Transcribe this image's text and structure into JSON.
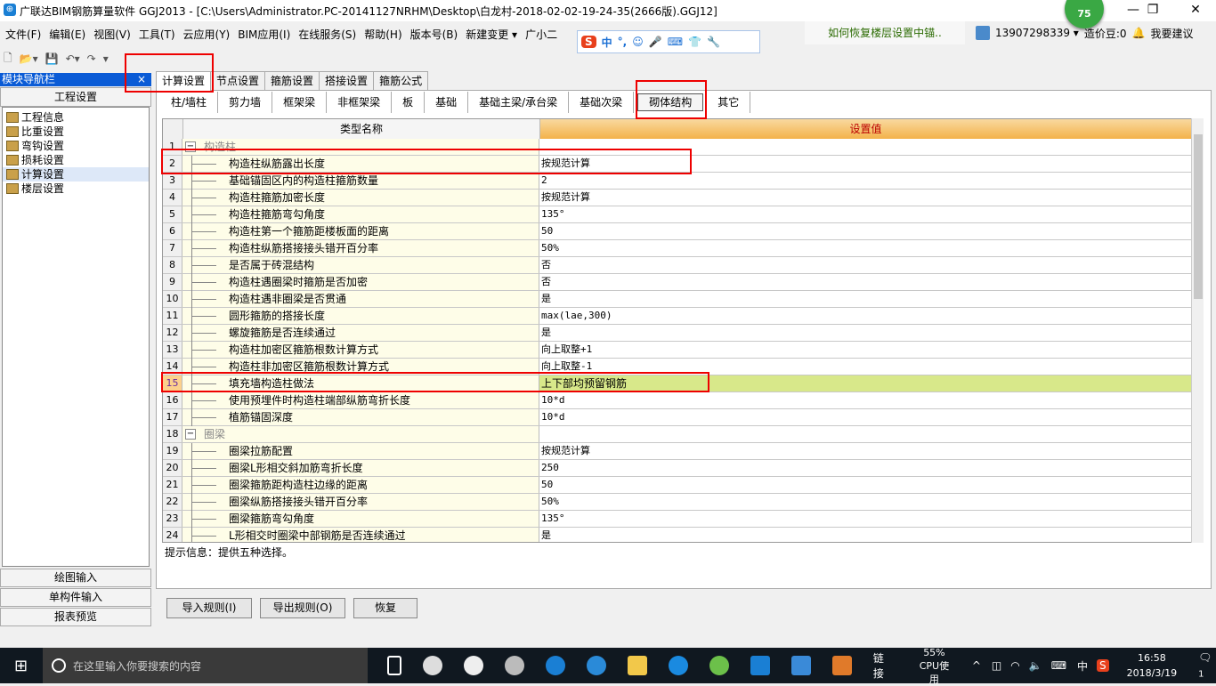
{
  "window": {
    "title": "广联达BIM钢筋算量软件 GGJ2013 - [C:\\Users\\Administrator.PC-20141127NRHM\\Desktop\\白龙村-2018-02-02-19-24-35(2666版).GGJ12]",
    "badge": "75",
    "minimize": "—",
    "restore": "❐",
    "close": "✕"
  },
  "menu": [
    "文件(F)",
    "编辑(E)",
    "视图(V)",
    "工具(T)",
    "云应用(Y)",
    "BIM应用(I)",
    "在线服务(S)",
    "帮助(H)",
    "版本号(B)",
    "新建变更 ▾",
    "广小二"
  ],
  "ime": {
    "logo": "S",
    "items": [
      "中",
      "°,",
      "☺",
      "🎤",
      "⌨",
      "👕",
      "🔧"
    ]
  },
  "news": "如何恢复楼层设置中锚..",
  "user": {
    "phone": "13907298339 ▾",
    "beans": "造价豆:0",
    "suggest": "我要建议"
  },
  "toolbar": [
    "🗋",
    "📂▾",
    "💾",
    "↶▾",
    "↷",
    "▾"
  ],
  "nav": {
    "header": "模块导航栏",
    "pin": "ᵖ",
    "close": "×",
    "section": "工程设置",
    "items": [
      "工程信息",
      "比重设置",
      "弯钩设置",
      "损耗设置",
      "计算设置",
      "楼层设置"
    ],
    "bottom": [
      "绘图输入",
      "单构件输入",
      "报表预览"
    ]
  },
  "main_tabs": [
    "计算设置",
    "节点设置",
    "箍筋设置",
    "搭接设置",
    "箍筋公式"
  ],
  "sub_tabs": [
    "柱/墙柱",
    "剪力墙",
    "框架梁",
    "非框架梁",
    "板",
    "基础",
    "基础主梁/承台梁",
    "基础次梁",
    "砌体结构",
    "其它"
  ],
  "grid": {
    "headers": [
      "类型名称",
      "设置值"
    ],
    "rows": [
      [
        "1",
        "构造柱",
        ""
      ],
      [
        "2",
        "构造柱纵筋露出长度",
        "按规范计算"
      ],
      [
        "3",
        "基础锚固区内的构造柱箍筋数量",
        "2"
      ],
      [
        "4",
        "构造柱箍筋加密长度",
        "按规范计算"
      ],
      [
        "5",
        "构造柱箍筋弯勾角度",
        "135°"
      ],
      [
        "6",
        "构造柱第一个箍筋距楼板面的距离",
        "50"
      ],
      [
        "7",
        "构造柱纵筋搭接接头错开百分率",
        "50%"
      ],
      [
        "8",
        "是否属于砖混结构",
        "否"
      ],
      [
        "9",
        "构造柱遇圈梁时箍筋是否加密",
        "否"
      ],
      [
        "10",
        "构造柱遇非圈梁是否贯通",
        "是"
      ],
      [
        "11",
        "圆形箍筋的搭接长度",
        "max(lae,300)"
      ],
      [
        "12",
        "螺旋箍筋是否连续通过",
        "是"
      ],
      [
        "13",
        "构造柱加密区箍筋根数计算方式",
        "向上取整+1"
      ],
      [
        "14",
        "构造柱非加密区箍筋根数计算方式",
        "向上取整-1"
      ],
      [
        "15",
        "填充墙构造柱做法",
        "上下部均预留钢筋"
      ],
      [
        "16",
        "使用预埋件时构造柱端部纵筋弯折长度",
        "10*d"
      ],
      [
        "17",
        "植筋锚固深度",
        "10*d"
      ],
      [
        "18",
        "圈梁",
        ""
      ],
      [
        "19",
        "圈梁拉筋配置",
        "按规范计算"
      ],
      [
        "20",
        "圈梁L形相交斜加筋弯折长度",
        "250"
      ],
      [
        "21",
        "圈梁箍筋距构造柱边缘的距离",
        "50"
      ],
      [
        "22",
        "圈梁纵筋搭接接头错开百分率",
        "50%"
      ],
      [
        "23",
        "圈梁箍筋弯勾角度",
        "135°"
      ],
      [
        "24",
        "L形相交时圈梁中部钢筋是否连续通过",
        "是"
      ]
    ]
  },
  "hint": "提示信息：提供五种选择。",
  "buttons": [
    "导入规则(I)",
    "导出规则(O)",
    "恢复"
  ],
  "taskbar": {
    "search": "在这里输入你要搜索的内容",
    "link": "链接",
    "cpu": "55%",
    "cpu_label": "CPU使用",
    "ime": "中",
    "time": "16:58",
    "date": "2018/3/19",
    "notif": "1"
  },
  "colors": {
    "accent": "#0a5bd6",
    "selected_value_bg": "#d8e88a",
    "header_value": "#f5b84a",
    "name_col_bg": "#fefde8",
    "annotation": "#e00000"
  }
}
